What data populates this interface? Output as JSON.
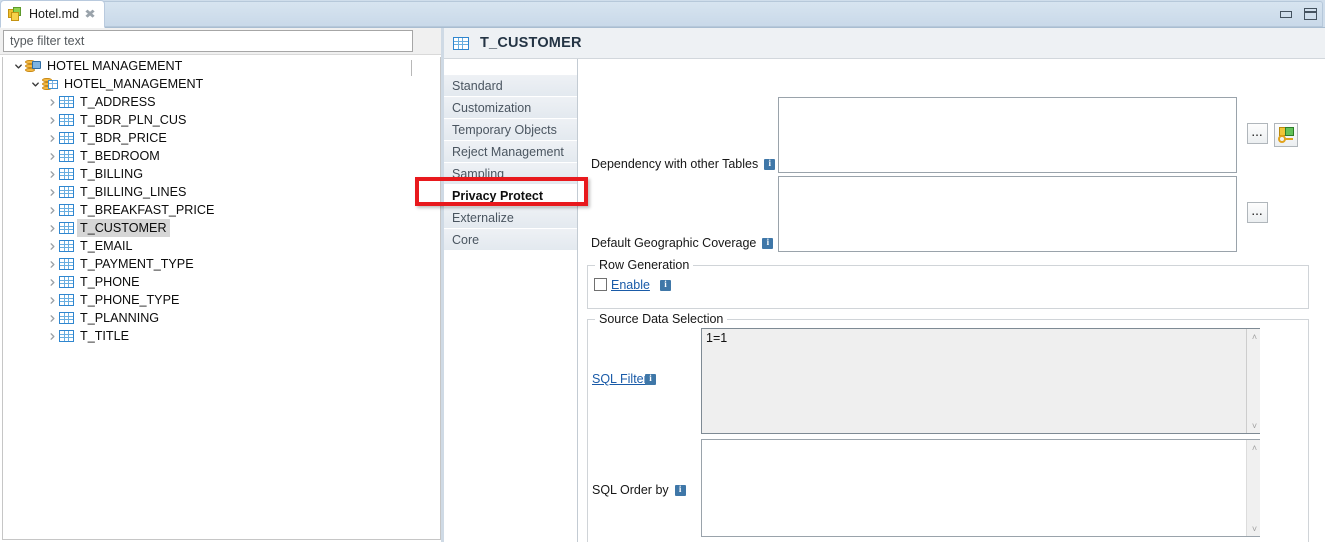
{
  "window": {
    "minimize_icon": "minimize-icon",
    "maximize_icon": "maximize-icon"
  },
  "editor_tab": {
    "label": "Hotel.md",
    "close_glyph": "✖",
    "icon": "model-file-icon"
  },
  "explorer": {
    "filter_placeholder": "type filter text",
    "filter_value": "",
    "filter_icon": "funnel-icon",
    "tree": [
      {
        "label": "HOTEL MANAGEMENT",
        "depth": 0,
        "icon": "server-icon",
        "twisty": "expanded",
        "selected": false
      },
      {
        "label": "HOTEL_MANAGEMENT",
        "depth": 1,
        "icon": "schema-icon",
        "twisty": "expanded",
        "selected": false
      },
      {
        "label": "T_ADDRESS",
        "depth": 2,
        "icon": "table-icon",
        "twisty": "collapsed",
        "selected": false
      },
      {
        "label": "T_BDR_PLN_CUS",
        "depth": 2,
        "icon": "table-icon",
        "twisty": "collapsed",
        "selected": false
      },
      {
        "label": "T_BDR_PRICE",
        "depth": 2,
        "icon": "table-icon",
        "twisty": "collapsed",
        "selected": false
      },
      {
        "label": "T_BEDROOM",
        "depth": 2,
        "icon": "table-icon",
        "twisty": "collapsed",
        "selected": false
      },
      {
        "label": "T_BILLING",
        "depth": 2,
        "icon": "table-icon",
        "twisty": "collapsed",
        "selected": false
      },
      {
        "label": "T_BILLING_LINES",
        "depth": 2,
        "icon": "table-icon",
        "twisty": "collapsed",
        "selected": false
      },
      {
        "label": "T_BREAKFAST_PRICE",
        "depth": 2,
        "icon": "table-icon",
        "twisty": "collapsed",
        "selected": false
      },
      {
        "label": "T_CUSTOMER",
        "depth": 2,
        "icon": "table-icon",
        "twisty": "collapsed",
        "selected": true
      },
      {
        "label": "T_EMAIL",
        "depth": 2,
        "icon": "table-icon",
        "twisty": "collapsed",
        "selected": false
      },
      {
        "label": "T_PAYMENT_TYPE",
        "depth": 2,
        "icon": "table-icon",
        "twisty": "collapsed",
        "selected": false
      },
      {
        "label": "T_PHONE",
        "depth": 2,
        "icon": "table-icon",
        "twisty": "collapsed",
        "selected": false
      },
      {
        "label": "T_PHONE_TYPE",
        "depth": 2,
        "icon": "table-icon",
        "twisty": "collapsed",
        "selected": false
      },
      {
        "label": "T_PLANNING",
        "depth": 2,
        "icon": "table-icon",
        "twisty": "collapsed",
        "selected": false
      },
      {
        "label": "T_TITLE",
        "depth": 2,
        "icon": "table-icon",
        "twisty": "collapsed",
        "selected": false
      }
    ]
  },
  "form": {
    "header_title": "T_CUSTOMER",
    "header_icon": "table-icon",
    "tabs": [
      {
        "label": "Standard",
        "selected": false
      },
      {
        "label": "Customization",
        "selected": false
      },
      {
        "label": "Temporary Objects",
        "selected": false
      },
      {
        "label": "Reject Management",
        "selected": false
      },
      {
        "label": "Sampling",
        "selected": false
      },
      {
        "label": "Privacy Protect",
        "selected": true
      },
      {
        "label": "Externalize",
        "selected": false
      },
      {
        "label": "Core",
        "selected": false
      }
    ],
    "fields": {
      "dependency": {
        "label": "Dependency with other Tables",
        "value": "",
        "info_icon": "info-icon",
        "browse_button": "...",
        "picker_icon": "key-table-icon"
      },
      "geographic": {
        "label": "Default Geographic Coverage",
        "value": "",
        "info_icon": "info-icon",
        "browse_button": "..."
      }
    },
    "row_generation": {
      "title": "Row Generation",
      "enable_label": "Enable",
      "enable_checked": false,
      "info_icon": "info-icon"
    },
    "source_data_selection": {
      "title": "Source Data Selection",
      "sql_filter": {
        "label": "SQL Filter",
        "value": "1=1",
        "info_icon": "info-icon",
        "readonly": true
      },
      "sql_order_by": {
        "label": "SQL Order by",
        "value": "",
        "info_icon": "info-icon",
        "readonly": false
      }
    }
  },
  "highlight": {
    "target": "Privacy Protect",
    "color": "#e8191d"
  },
  "scroll_glyphs": {
    "up": "˄",
    "down": "˅"
  }
}
